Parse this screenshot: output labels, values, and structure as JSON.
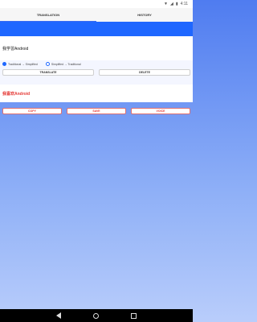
{
  "status_bar": {
    "time": "4:11",
    "wifi_icon": "wifi-icon",
    "signal_icon": "signal-icon",
    "battery_icon": "battery-icon"
  },
  "tabs": [
    {
      "label": "TRANSLATION",
      "active": true
    },
    {
      "label": "HISTORY",
      "active": false
    }
  ],
  "input": {
    "text": "我学習Android"
  },
  "options": [
    {
      "label": "Traditional → Simplified",
      "checked": true
    },
    {
      "label": "Simplified → Traditional",
      "checked": false
    }
  ],
  "buttons": {
    "translate": "TRANSLATE",
    "delete": "DELETE"
  },
  "result": {
    "text": "我喜欢Android"
  },
  "actions": {
    "copy": "COPY",
    "save": "SAVE",
    "voice": "VOICE"
  },
  "colors": {
    "accent_blue": "#1f67ff",
    "result_red": "#e53935"
  }
}
